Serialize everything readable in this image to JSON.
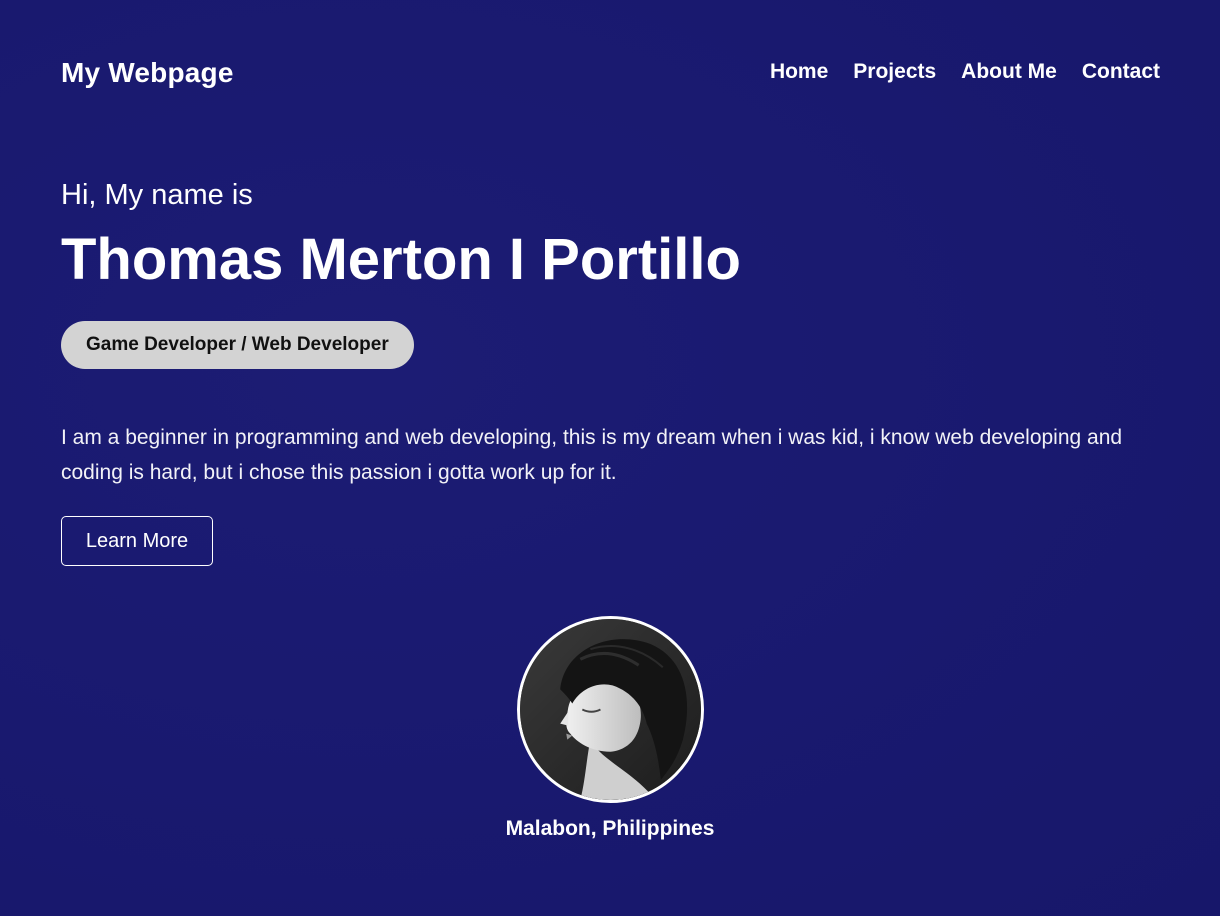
{
  "header": {
    "brand": "My Webpage",
    "nav": [
      {
        "label": "Home"
      },
      {
        "label": "Projects"
      },
      {
        "label": "About Me"
      },
      {
        "label": "Contact"
      }
    ]
  },
  "hero": {
    "greeting": "Hi, My name is",
    "name": "Thomas Merton I Portillo",
    "role": "Game Developer / Web Developer",
    "bio": "I am a beginner in programming and web developing, this is my dream when i was kid, i know web developing and coding is hard, but i chose this passion i gotta work up for it.",
    "cta_label": "Learn More"
  },
  "profile": {
    "avatar_icon": "profile-photo",
    "location": "Malabon, Philippines"
  },
  "colors": {
    "background": "#19196f",
    "text": "#ffffff",
    "pill_bg": "#d3d3d3",
    "pill_text": "#111111"
  }
}
